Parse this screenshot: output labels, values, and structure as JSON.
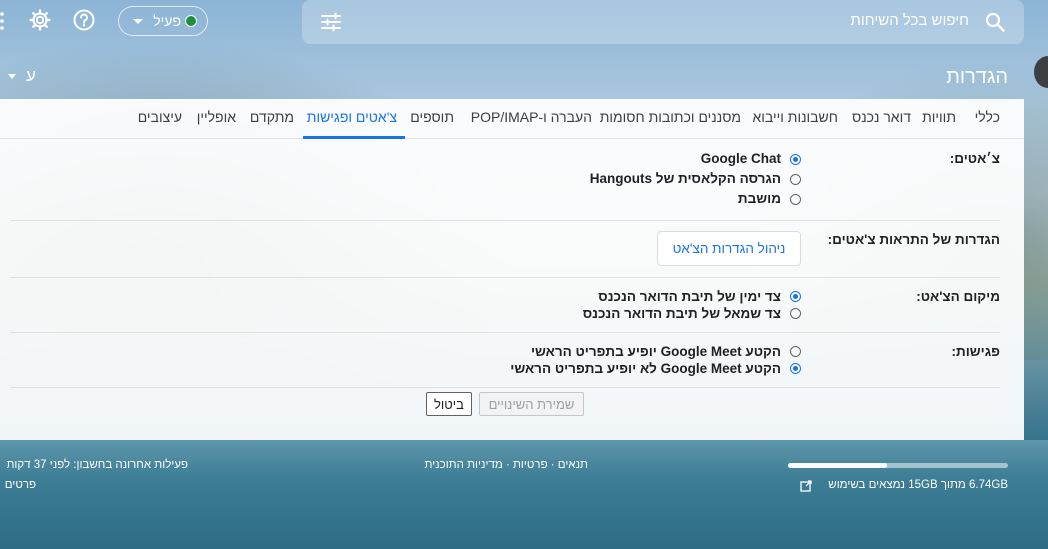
{
  "search": {
    "placeholder": "חיפוש בכל השיחות"
  },
  "status": {
    "label": "פעיל",
    "color": "#1e8e3e"
  },
  "header": {
    "title": "הגדרות",
    "lang_indicator": "ע"
  },
  "tabs": [
    {
      "label": "כללי",
      "active": false
    },
    {
      "label": "תוויות",
      "active": false
    },
    {
      "label": "דואר נכנס",
      "active": false
    },
    {
      "label": "חשבונות וייבוא",
      "active": false
    },
    {
      "label": "מסננים וכתובות חסומות",
      "active": false
    },
    {
      "label": "העברה ו-POP/IMAP",
      "active": false
    },
    {
      "label": "תוספים",
      "active": false
    },
    {
      "label": "צ'אטים ופגישות",
      "active": true
    },
    {
      "label": "מתקדם",
      "active": false
    },
    {
      "label": "אופליין",
      "active": false
    },
    {
      "label": "עיצובים",
      "active": false
    }
  ],
  "chat": {
    "label": "צ׳אטים:",
    "options": [
      {
        "label": "Google Chat",
        "selected": true
      },
      {
        "label": "הגרסה הקלאסית של Hangouts",
        "selected": false
      },
      {
        "label": "מושבת",
        "selected": false
      }
    ]
  },
  "notifications": {
    "label": "הגדרות של התראות צ'אטים:",
    "button": "ניהול הגדרות הצ'אט"
  },
  "position": {
    "label": "מיקום הצ'אט:",
    "options": [
      {
        "label": "צד ימין של תיבת הדואר הנכנס",
        "selected": true
      },
      {
        "label": "צד שמאל של תיבת הדואר הנכנס",
        "selected": false
      }
    ]
  },
  "meetings": {
    "label": "פגישות:",
    "options": [
      {
        "label": "הקטע Google Meet יופיע בתפריט הראשי",
        "selected": false
      },
      {
        "label": "הקטע Google Meet לא יופיע בתפריט הראשי",
        "selected": true
      }
    ]
  },
  "actions": {
    "save": "שמירת השינויים",
    "cancel": "ביטול"
  },
  "footer": {
    "storage": "6.74GB מתוך 15GB נמצאים בשימוש",
    "storage_fraction": 0.45,
    "links": "תנאים · פרטיות · מדיניות התוכנית",
    "activity": "פעילות אחרונה בחשבון: לפני 37 דקות",
    "details": "פרטים"
  },
  "colors": {
    "accent": "#1a73e8"
  }
}
